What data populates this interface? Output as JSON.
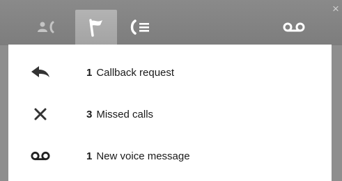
{
  "tabs": [
    {
      "name": "contacts",
      "icon": "contacts-icon",
      "active": false
    },
    {
      "name": "notifications",
      "icon": "flag-icon",
      "active": true
    },
    {
      "name": "call-list",
      "icon": "call-list-icon",
      "active": false
    },
    {
      "name": "voicemail",
      "icon": "voicemail-icon",
      "active": false
    }
  ],
  "close_glyph": "×",
  "notifications": [
    {
      "icon": "callback-arrow-icon",
      "count": "1",
      "label": "Callback request"
    },
    {
      "icon": "missed-call-x-icon",
      "count": "3",
      "label": "Missed calls"
    },
    {
      "icon": "voicemail-icon",
      "count": "1",
      "label": "New voice message"
    }
  ],
  "colors": {
    "tabbar": "#838383",
    "active_tab": "#ababab",
    "icon_light": "#ffffff",
    "icon_dim": "#c4c4c4",
    "panel_bg": "#ffffff",
    "text": "#1a1a1a",
    "row_icon": "#333333"
  }
}
